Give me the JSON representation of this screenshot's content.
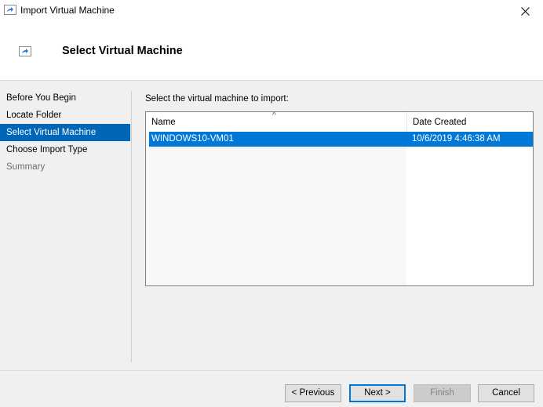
{
  "window": {
    "title": "Import Virtual Machine",
    "icon": "import-vm-icon",
    "close_icon": "close-icon"
  },
  "header": {
    "title": "Select Virtual Machine",
    "icon": "import-vm-icon"
  },
  "steps": [
    {
      "label": "Before You Begin",
      "state": "normal"
    },
    {
      "label": "Locate Folder",
      "state": "normal"
    },
    {
      "label": "Select Virtual Machine",
      "state": "active"
    },
    {
      "label": "Choose Import Type",
      "state": "normal"
    },
    {
      "label": "Summary",
      "state": "disabled"
    }
  ],
  "main": {
    "prompt": "Select the virtual machine to import:",
    "list": {
      "columns": [
        "Name",
        "Date Created"
      ],
      "sort_indicator": "^",
      "rows": [
        {
          "name": "WINDOWS10-VM01",
          "date_created": "10/6/2019 4:46:38 AM",
          "selected": true
        }
      ]
    }
  },
  "buttons": {
    "previous": "< Previous",
    "next": "Next >",
    "finish": "Finish",
    "cancel": "Cancel"
  },
  "colors": {
    "selection": "#0078d7",
    "active_step": "#0066b8"
  }
}
